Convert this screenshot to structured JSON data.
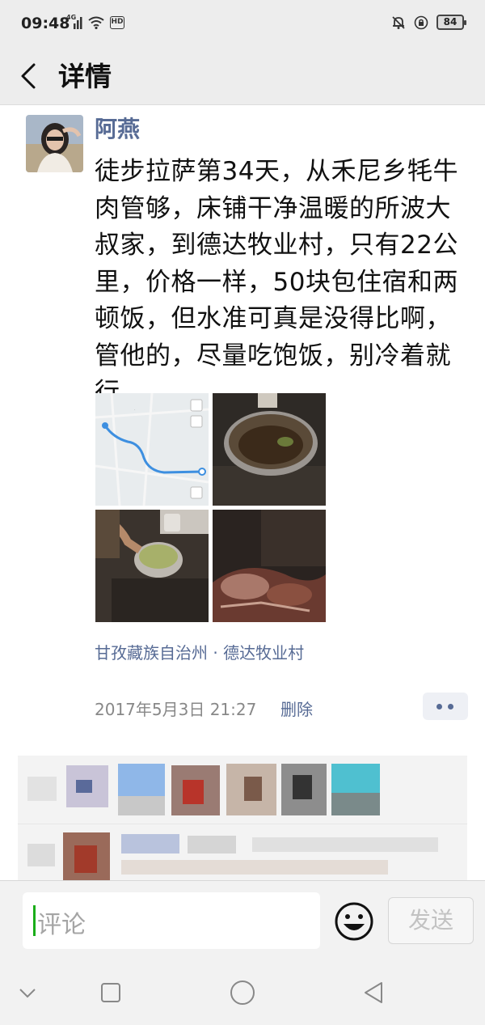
{
  "status_bar": {
    "time": "09:48",
    "network": "4G",
    "hd_label": "HD",
    "battery": "84"
  },
  "header": {
    "title": "详情"
  },
  "post": {
    "author": "阿燕",
    "text": "徒步拉萨第34天，从禾尼乡牦牛肉管够，床铺干净温暖的所波大叔家，到德达牧业村，只有22公里，价格一样，50块包住宿和两顿饭，但水准可真是没得比啊，管他的，尽量吃饱饭，别冷着就行",
    "photos": [
      "route-map-photo",
      "cooking-pot-photo",
      "stove-cooking-photo",
      "bedding-photo"
    ],
    "location": "甘孜藏族自治州 · 德达牧业村",
    "time": "2017年5月3日 21:27",
    "delete_label": "删除"
  },
  "comment_bar": {
    "placeholder": "评论",
    "send_label": "发送"
  },
  "colors": {
    "link": "#576b95",
    "accent_green": "#1aad19",
    "nav_background": "#ededed"
  }
}
